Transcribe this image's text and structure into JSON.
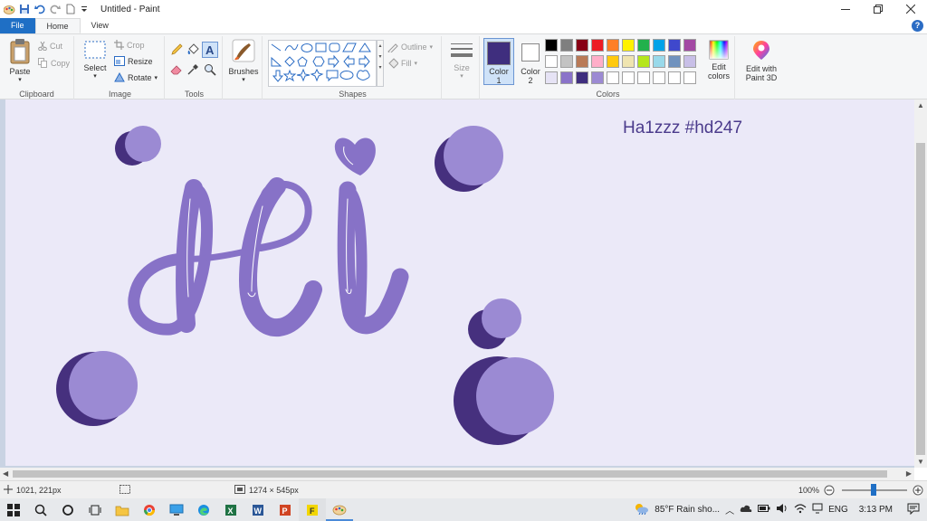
{
  "app": {
    "title": "Untitled - Paint"
  },
  "tabs": [
    {
      "label": "File"
    },
    {
      "label": "Home"
    },
    {
      "label": "View"
    }
  ],
  "help_label": "?",
  "ribbon": {
    "clipboard": {
      "paste": "Paste",
      "cut": "Cut",
      "copy": "Copy",
      "group": "Clipboard"
    },
    "image": {
      "select": "Select",
      "crop": "Crop",
      "resize": "Resize",
      "rotate": "Rotate",
      "group": "Image"
    },
    "tools": {
      "group": "Tools"
    },
    "brushes": {
      "label": "Brushes"
    },
    "shapes": {
      "outline": "Outline",
      "fill": "Fill",
      "group": "Shapes"
    },
    "size": {
      "label": "Size"
    },
    "colors": {
      "color1": "Color",
      "color1_num": "1",
      "color2": "Color",
      "color2_num": "2",
      "edit": "Edit",
      "edit2": "colors",
      "group": "Colors",
      "color1_value": "#3f2e7e",
      "color2_value": "#ffffff",
      "palette_row1": [
        "#000000",
        "#7f7f7f",
        "#880015",
        "#ed1c24",
        "#ff7f27",
        "#fff200",
        "#22b14c",
        "#00a2e8",
        "#3f48cc",
        "#a349a4"
      ],
      "palette_row2": [
        "#ffffff",
        "#c3c3c3",
        "#b97a57",
        "#ffaec9",
        "#ffc90e",
        "#efe4b0",
        "#b5e61d",
        "#99d9ea",
        "#7092be",
        "#c8bfe7"
      ],
      "palette_row3": [
        "#e6e3f5",
        "#8a73c9",
        "#3f2e7e",
        "#9c8ad3",
        "#ffffff",
        "#ffffff",
        "#ffffff",
        "#ffffff",
        "#ffffff",
        "#ffffff"
      ]
    },
    "paint3d": {
      "line1": "Edit with",
      "line2": "Paint 3D"
    }
  },
  "canvas": {
    "watermark": "Ha1zzz #hd247",
    "background": "#ebe9f8",
    "dark_purple": "#46307e",
    "light_purple": "#9b8ad3",
    "letter_purple": "#8772c7"
  },
  "status": {
    "cursor": "1021, 221px",
    "size": "1274 × 545px",
    "zoom": "100%"
  },
  "taskbar": {
    "weather": "85°F  Rain sho...",
    "lang": "ENG",
    "time": "3:13 PM"
  }
}
